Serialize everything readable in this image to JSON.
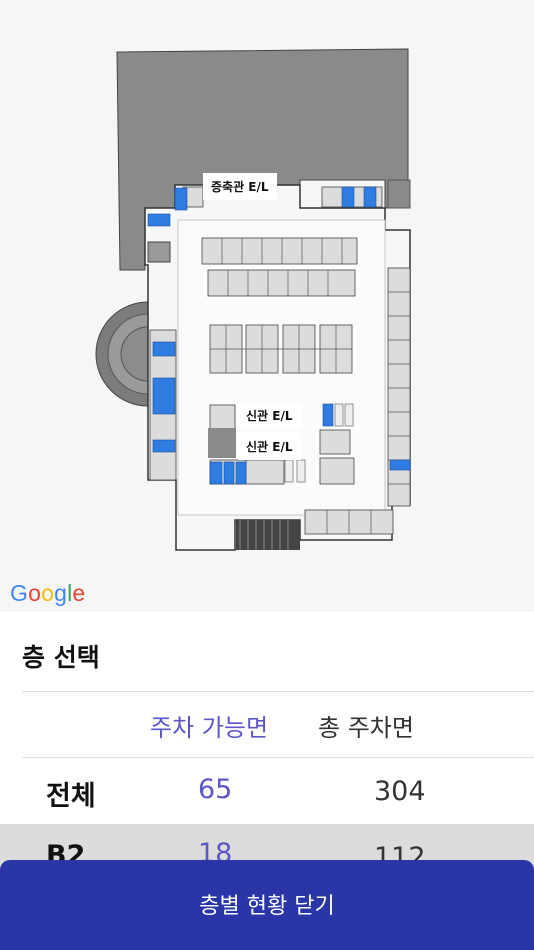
{
  "map": {
    "elevator_labels": [
      "증축관 E/L",
      "신관 E/L",
      "신관 E/L"
    ],
    "attribution": "Google",
    "colors": {
      "outer_block": "#8a8a8a",
      "floor": "#f7f7f7",
      "stall": "#d8d8d8",
      "accessible_stall": "#2f7de1"
    }
  },
  "panel": {
    "title": "층 선택",
    "columns": {
      "available": "주차 가능면",
      "total": "총 주차면"
    },
    "rows": [
      {
        "floor": "전체",
        "available": "65",
        "total": "304"
      },
      {
        "floor": "B2",
        "available": "18",
        "total": "112"
      }
    ]
  },
  "close_button": {
    "label": "층별 현황 닫기"
  },
  "theme": {
    "accent": "#5b57c9",
    "button": "#2a35a7"
  }
}
